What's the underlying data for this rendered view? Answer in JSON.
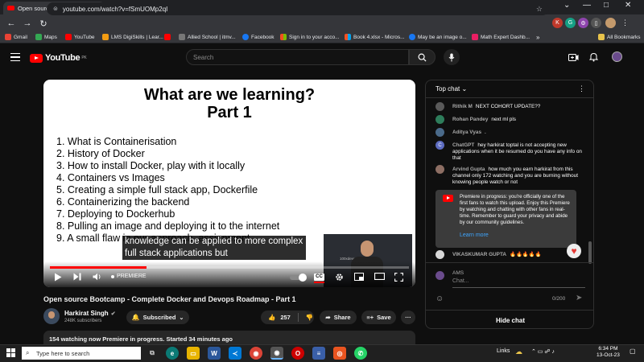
{
  "browser": {
    "tab_title": "Open source Bootcamp - Comp",
    "new_tab": "+",
    "url": "youtube.com/watch?v=fSmUOMp2qI",
    "bookmarks": [
      "Gmail",
      "Maps",
      "YouTube",
      "LMS DigiSkills | Lear...",
      "Allied School | itmv...",
      "Facebook",
      "Sign in to your acco...",
      "Book 4.xlsx - Micros...",
      "May be an image o...",
      "Math Expert Dashb..."
    ],
    "all_bookmarks": "All Bookmarks",
    "window_controls": [
      "⌄",
      "—",
      "□",
      "✕"
    ]
  },
  "youtube": {
    "logo": "YouTube",
    "region": "PK",
    "search_placeholder": "Search"
  },
  "player": {
    "slide_title_1": "What are we learning?",
    "slide_title_2": "Part 1",
    "slide_items": [
      "1. What is Containerisation",
      "2. History of Docker",
      "3. How to install Docker, play with it locally",
      "4. Containers vs Images",
      "5. Creating a simple full stack app, Dockerfile",
      "6. Containerizing the backend",
      "7. Deploying to Dockerhub",
      "8. Pulling an image and deploying it to the internet",
      "9. A small flaw in our approach, assignment"
    ],
    "subtitle_1": "knowledge can be applied to more complex",
    "subtitle_2": "full stack applications but",
    "pip_caption": "100xdevs  Bootcamp",
    "premiere_label": "PREMIERE",
    "cc_label": "CC",
    "progress_percent": 27
  },
  "video": {
    "title": "Open source Bootcamp - Complete Docker and Devops Roadmap - Part 1",
    "channel": "Harkirat Singh",
    "subscribers": "248K subscribers",
    "subscribed_label": "Subscribed",
    "likes": "257",
    "share_label": "Share",
    "save_label": "Save",
    "more_label": "···",
    "description_summary": "154 watching now  Premiere in progress. Started 34 minutes ago"
  },
  "chat": {
    "header": "Top chat",
    "messages": [
      {
        "name": "Rithik M",
        "text": "NEXT COHORT UPDATE??",
        "avatar": "",
        "color": "#5a5a5a"
      },
      {
        "name": "Rohan Pandey",
        "text": "next ml pls",
        "avatar": "",
        "color": "#2e7d5b"
      },
      {
        "name": "Aditya Vyas",
        "text": ".",
        "avatar": "",
        "color": "#4a6a8a"
      },
      {
        "name": "ChatGPT",
        "text": "hey harkirat toptal is not accepting new applications when it be resumed do you have any info on that",
        "avatar": "C",
        "color": "#5c6bc0"
      },
      {
        "name": "Arvind Gupta",
        "text": "how much you earn harkirat from this channel only 172 watching and you are burning without knowing people watch or not",
        "avatar": "",
        "color": "#8d6e63"
      }
    ],
    "banner_text": "Premiere in progress: you're officially one of the first fans to watch this upload. Enjoy this Premiere by watching and chatting with other fans in real-time. Remember to guard your privacy and abide by our community guidelines.",
    "banner_link": "Learn more",
    "last_message_name": "VIKASKUMAR GUPTA",
    "last_message_text": "🔥🔥🔥🔥🔥",
    "input_user": "AMS",
    "input_placeholder": "Chat...",
    "counter": "0/200",
    "hide_chat": "Hide chat"
  },
  "taskbar": {
    "search_placeholder": "Type here to search",
    "links_label": "Links",
    "time": "6:34 PM",
    "date": "13-Oct-23"
  }
}
